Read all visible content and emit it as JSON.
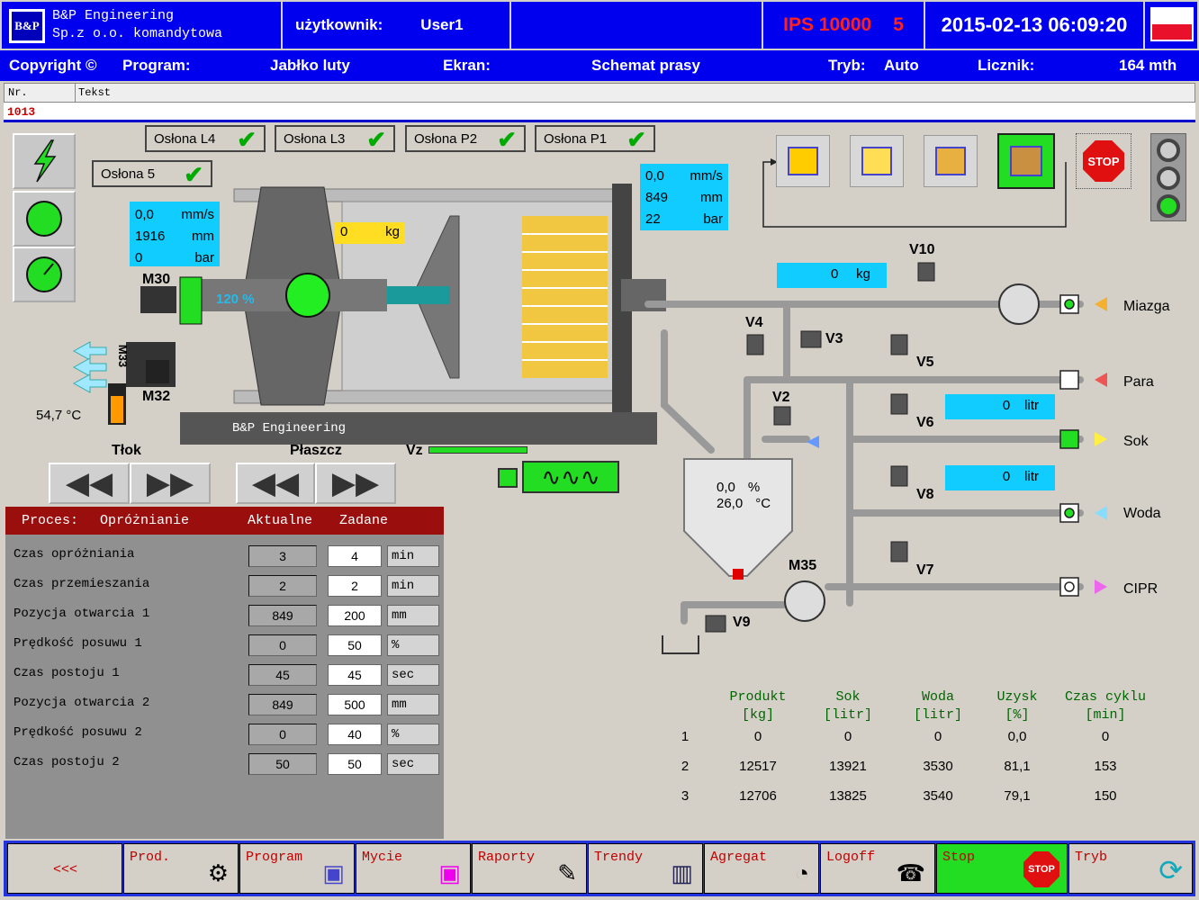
{
  "header": {
    "company_line1": "B&P Engineering",
    "company_line2": "Sp.z o.o. komandytowa",
    "user_label": "użytkownik:",
    "user_value": "User1",
    "ips_label": "IPS 10000",
    "ips_number": "5",
    "datetime": "2015-02-13 06:09:20",
    "logo_text": "B&P"
  },
  "subheader": {
    "copyright": "Copyright ©",
    "program_label": "Program:",
    "program_value": "Jabłko luty",
    "screen_label": "Ekran:",
    "screen_value": "Schemat prasy",
    "mode_label": "Tryb:",
    "mode_value": "Auto",
    "counter_label": "Licznik:",
    "counter_value": "164 mth"
  },
  "messages": {
    "col_nr": "Nr.",
    "col_text": "Tekst",
    "row_nr": "1013"
  },
  "guards": [
    {
      "label": "Osłona L4"
    },
    {
      "label": "Osłona L3"
    },
    {
      "label": "Osłona P2"
    },
    {
      "label": "Osłona P1"
    },
    {
      "label": "Osłona 5"
    }
  ],
  "left_readout": {
    "speed": "0,0",
    "speed_unit": "mm/s",
    "pos": "1916",
    "pos_unit": "mm",
    "press": "0",
    "press_unit": "bar"
  },
  "right_readout": {
    "speed": "0,0",
    "speed_unit": "mm/s",
    "pos": "849",
    "pos_unit": "mm",
    "press": "22",
    "press_unit": "bar"
  },
  "weight_press": {
    "value": "0",
    "unit": "kg"
  },
  "weight_line": {
    "value": "0",
    "unit": "kg"
  },
  "motors": {
    "m30": "M30",
    "m33": "M33",
    "m32": "M32",
    "m35": "M35",
    "m30_pct": "120 %"
  },
  "temp": "54,7 °C",
  "press_nameplate": "B&P Engineering",
  "labels": {
    "tlok": "Tłok",
    "plaszcz": "Płaszcz",
    "vz": "Vz"
  },
  "valves": {
    "v1": "V10",
    "v4": "V4",
    "v3": "V3",
    "v5": "V5",
    "v2": "V2",
    "v6": "V6",
    "v8": "V8",
    "v7": "V7",
    "v9": "V9"
  },
  "flow_sok": {
    "value": "0",
    "unit": "litr"
  },
  "flow_woda": {
    "value": "0",
    "unit": "litr"
  },
  "tank": {
    "level": "0,0",
    "level_unit": "%",
    "temp": "26,0",
    "temp_unit": "°C"
  },
  "lines": {
    "miazga": "Miazga",
    "para": "Para",
    "sok": "Sok",
    "woda": "Woda",
    "cipr": "CIPR"
  },
  "process": {
    "title": "Proces:",
    "state": "Opróżnianie",
    "col_actual": "Aktualne",
    "col_set": "Zadane",
    "rows": [
      {
        "label": "Czas opróżniania",
        "actual": "3",
        "set": "4",
        "unit": "min"
      },
      {
        "label": "Czas przemieszania",
        "actual": "2",
        "set": "2",
        "unit": "min"
      },
      {
        "label": "Pozycja otwarcia 1",
        "actual": "849",
        "set": "200",
        "unit": "mm"
      },
      {
        "label": "Prędkość posuwu 1",
        "actual": "0",
        "set": "50",
        "unit": "%"
      },
      {
        "label": "Czas postoju 1",
        "actual": "45",
        "set": "45",
        "unit": "sec"
      },
      {
        "label": "Pozycja otwarcia 2",
        "actual": "849",
        "set": "500",
        "unit": "mm"
      },
      {
        "label": "Prędkość posuwu 2",
        "actual": "0",
        "set": "40",
        "unit": "%"
      },
      {
        "label": "Czas postoju 2",
        "actual": "50",
        "set": "50",
        "unit": "sec"
      }
    ]
  },
  "results": {
    "headers": [
      [
        "Produkt",
        "[kg]"
      ],
      [
        "Sok",
        "[litr]"
      ],
      [
        "Woda",
        "[litr]"
      ],
      [
        "Uzysk",
        "[%]"
      ],
      [
        "Czas cyklu",
        "[min]"
      ]
    ],
    "rows": [
      {
        "n": "1",
        "v": [
          "0",
          "0",
          "0",
          "0,0",
          "0"
        ]
      },
      {
        "n": "2",
        "v": [
          "12517",
          "13921",
          "3530",
          "81,1",
          "153"
        ]
      },
      {
        "n": "3",
        "v": [
          "12706",
          "13825",
          "3540",
          "79,1",
          "150"
        ]
      }
    ]
  },
  "stop_sign": "STOP",
  "bottom": {
    "back": "<<<",
    "prod": "Prod.",
    "program": "Program",
    "mycie": "Mycie",
    "raporty": "Raporty",
    "trendy": "Trendy",
    "agregat": "Agregat",
    "logoff": "Logoff",
    "stop": "Stop",
    "tryb": "Tryb"
  },
  "colors": {
    "header_blue": "#0000ee",
    "process_red": "#9a0e0e",
    "readout_cyan": "#11ccff",
    "active_green": "#22dd22"
  }
}
